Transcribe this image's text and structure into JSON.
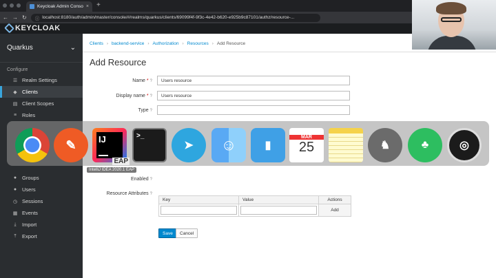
{
  "browser": {
    "tab_title": "Keycloak Admin Console",
    "tab_close": "×",
    "new_tab": "+",
    "url": "localhost:8180/auth/admin/master/console/#/realms/quarkus/clients/69099f4f-9f3c-4e42-b620-e925b9c87101/authz/resource-..."
  },
  "header": {
    "logo_text": "KEYCLOAK"
  },
  "sidebar": {
    "realm": "Quarkus",
    "section_configure": "Configure",
    "items": [
      {
        "label": "Realm Settings",
        "icon": "sliders-icon"
      },
      {
        "label": "Clients",
        "icon": "cube-icon"
      },
      {
        "label": "Client Scopes",
        "icon": "scopes-icon"
      },
      {
        "label": "Roles",
        "icon": "roles-icon"
      }
    ],
    "lower_items": [
      {
        "label": "Groups",
        "icon": "groups-icon"
      },
      {
        "label": "Users",
        "icon": "user-icon"
      },
      {
        "label": "Sessions",
        "icon": "clock-icon"
      },
      {
        "label": "Events",
        "icon": "calendar-icon"
      },
      {
        "label": "Import",
        "icon": "import-icon"
      },
      {
        "label": "Export",
        "icon": "export-icon"
      }
    ]
  },
  "breadcrumb": [
    "Clients",
    "backend-service",
    "Authorization",
    "Resources",
    "Add Resource"
  ],
  "page_title": "Add Resource",
  "form": {
    "name_label": "Name",
    "name_value": "Users resource",
    "display_name_label": "Display name",
    "display_name_value": "Users resource",
    "type_label": "Type",
    "type_value": "",
    "enabled_label": "Enabled",
    "attrs_label": "Resource Attributes",
    "col_key": "Key",
    "col_value": "Value",
    "col_actions": "Actions",
    "add_label": "Add"
  },
  "buttons": {
    "save": "Save",
    "cancel": "Cancel"
  },
  "dock": {
    "tooltip": "IntelliJ IDEA 2020.1 EAP",
    "apps": [
      "Google Chrome",
      "Postman",
      "IntelliJ IDEA",
      "Terminal",
      "Telegram",
      "Finder",
      "Day One",
      "Calendar",
      "Notes",
      "Mastodon",
      "Evernote",
      "OBS"
    ],
    "calendar_month": "MAR",
    "calendar_day": "25",
    "ij_text": "IJ",
    "eap_text": "EAP",
    "terminal_text": ">_"
  },
  "colors": {
    "accent": "#0088ce",
    "sidebar_bg": "#2a2d30",
    "header_bg": "#1b1d1f"
  }
}
